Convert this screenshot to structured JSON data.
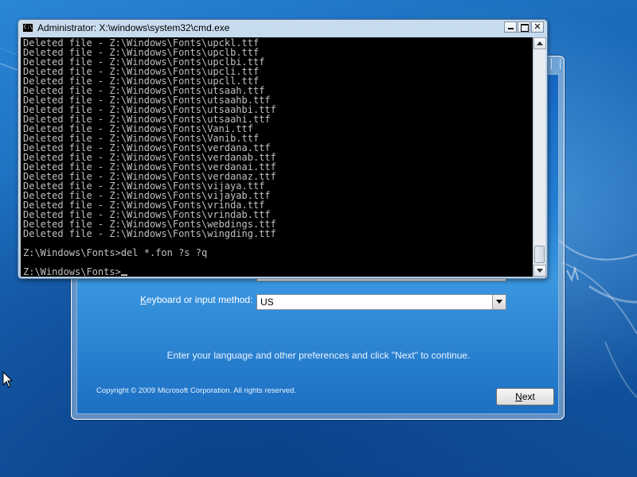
{
  "cmd_window": {
    "title": "Administrator: X:\\windows\\system32\\cmd.exe",
    "icon": "cmd-console-icon",
    "icon_text": "C:\\",
    "controls": {
      "minimize": "minimize-icon",
      "maximize": "maximize-icon",
      "close_glyph": "✕"
    },
    "console_lines": [
      "Deleted file - Z:\\Windows\\Fonts\\upckl.ttf",
      "Deleted file - Z:\\Windows\\Fonts\\upclb.ttf",
      "Deleted file - Z:\\Windows\\Fonts\\upclbi.ttf",
      "Deleted file - Z:\\Windows\\Fonts\\upcli.ttf",
      "Deleted file - Z:\\Windows\\Fonts\\upcll.ttf",
      "Deleted file - Z:\\Windows\\Fonts\\utsaah.ttf",
      "Deleted file - Z:\\Windows\\Fonts\\utsaahb.ttf",
      "Deleted file - Z:\\Windows\\Fonts\\utsaahbi.ttf",
      "Deleted file - Z:\\Windows\\Fonts\\utsaahi.ttf",
      "Deleted file - Z:\\Windows\\Fonts\\Vani.ttf",
      "Deleted file - Z:\\Windows\\Fonts\\Vanib.ttf",
      "Deleted file - Z:\\Windows\\Fonts\\verdana.ttf",
      "Deleted file - Z:\\Windows\\Fonts\\verdanab.ttf",
      "Deleted file - Z:\\Windows\\Fonts\\verdanai.ttf",
      "Deleted file - Z:\\Windows\\Fonts\\verdanaz.ttf",
      "Deleted file - Z:\\Windows\\Fonts\\vijaya.ttf",
      "Deleted file - Z:\\Windows\\Fonts\\vijayab.ttf",
      "Deleted file - Z:\\Windows\\Fonts\\vrinda.ttf",
      "Deleted file - Z:\\Windows\\Fonts\\vrindab.ttf",
      "Deleted file - Z:\\Windows\\Fonts\\webdings.ttf",
      "Deleted file - Z:\\Windows\\Fonts\\wingding.ttf",
      "",
      "Z:\\Windows\\Fonts>del *.fon ?s ?q",
      "",
      "Z:\\Windows\\Fonts>"
    ],
    "scroll_position": 0.92
  },
  "setup_window": {
    "keyboard_label_prefix": "K",
    "keyboard_label_rest": "eyboard or input method:",
    "keyboard_value": "US",
    "instruction": "Enter your language and other preferences and click \"Next\" to continue.",
    "copyright": "Copyright © 2009 Microsoft Corporation. All rights reserved.",
    "next_label_prefix": "N",
    "next_label_rest": "ext"
  },
  "colors": {
    "console_bg": "#000000",
    "console_text": "#c0c0c0",
    "desktop_blue": "#1f6fbd"
  }
}
